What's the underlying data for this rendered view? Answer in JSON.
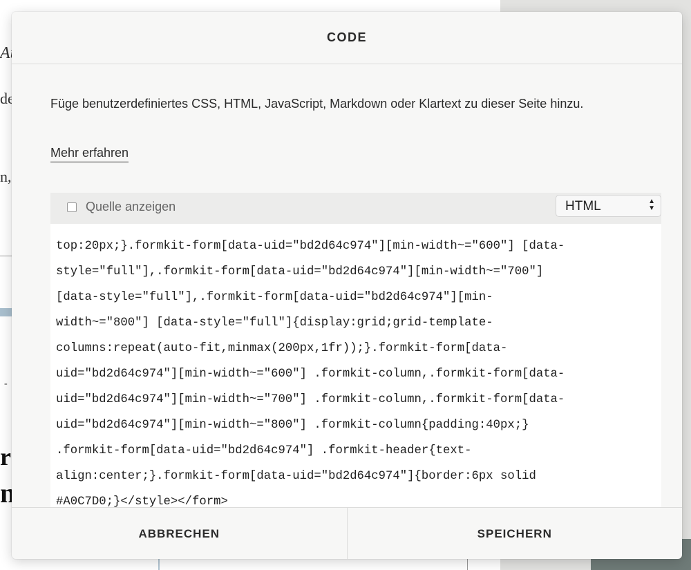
{
  "dialog": {
    "title": "CODE",
    "description": "Füge benutzerdefiniertes CSS, HTML, JavaScript, Markdown oder Klartext zu dieser Seite hinzu.",
    "learn_more": "Mehr erfahren",
    "show_source_label": "Quelle anzeigen",
    "show_source_checked": false,
    "language_selected": "HTML",
    "code_lines": [
      "top:20px;}.formkit-form[data-uid=\"bd2d64c974\"][min-width~=\"600\"] [data-",
      "style=\"full\"],.formkit-form[data-uid=\"bd2d64c974\"][min-width~=\"700\"]",
      "[data-style=\"full\"],.formkit-form[data-uid=\"bd2d64c974\"][min-",
      "width~=\"800\"] [data-style=\"full\"]{display:grid;grid-template-",
      "columns:repeat(auto-fit,minmax(200px,1fr));}.formkit-form[data-",
      "uid=\"bd2d64c974\"][min-width~=\"600\"] .formkit-column,.formkit-form[data-",
      "uid=\"bd2d64c974\"][min-width~=\"700\"] .formkit-column,.formkit-form[data-",
      "uid=\"bd2d64c974\"][min-width~=\"800\"] .formkit-column{padding:40px;}",
      ".formkit-form[data-uid=\"bd2d64c974\"] .formkit-header{text-",
      "align:center;}.formkit-form[data-uid=\"bd2d64c974\"]{border:6px solid",
      "#A0C7D0;}</style></form>"
    ],
    "cancel_label": "ABBRECHEN",
    "save_label": "SPEICHERN"
  },
  "background": {
    "fragments": [
      "Au",
      "de",
      "n,",
      "-",
      "r",
      "n",
      "?"
    ]
  }
}
